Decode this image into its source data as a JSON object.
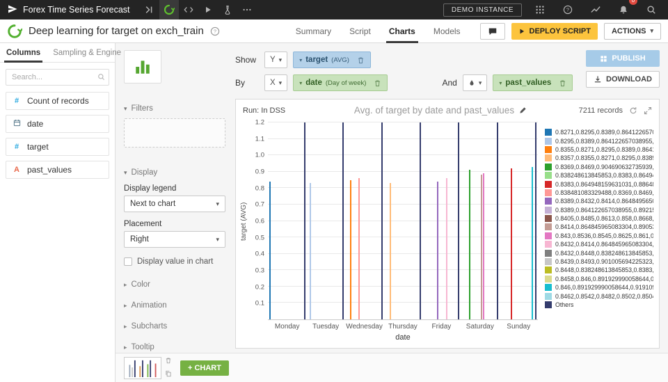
{
  "topnav": {
    "project_name": "Forex Time Series Forecast",
    "demo_instance_label": "DEMO INSTANCE",
    "notification_badge": "0"
  },
  "header": {
    "title": "Deep learning for target on exch_train",
    "tabs": [
      {
        "label": "Summary",
        "active": false
      },
      {
        "label": "Script",
        "active": false
      },
      {
        "label": "Charts",
        "active": true
      },
      {
        "label": "Models",
        "active": false
      }
    ],
    "deploy_button": "DEPLOY SCRIPT",
    "actions_button": "ACTIONS"
  },
  "sidebar": {
    "tabs": [
      {
        "label": "Columns",
        "active": true
      },
      {
        "label": "Sampling & Engine",
        "active": false
      }
    ],
    "search_placeholder": "Search...",
    "columns": [
      {
        "icon": "number",
        "name": "Count of records"
      },
      {
        "icon": "date",
        "name": "date"
      },
      {
        "icon": "number",
        "name": "target"
      },
      {
        "icon": "text",
        "name": "past_values"
      }
    ]
  },
  "config_panel": {
    "filters_label": "Filters",
    "display": {
      "label": "Display",
      "legend_label": "Display legend",
      "legend_value": "Next to chart",
      "placement_label": "Placement",
      "placement_value": "Right",
      "checkbox_label": "Display value in chart",
      "checkbox_checked": false
    },
    "collapsed_sections": [
      "Color",
      "Animation",
      "Subcharts",
      "Tooltip"
    ]
  },
  "chart_setup": {
    "show_label": "Show",
    "y_select": "Y",
    "y_field": "target",
    "y_qualifier": "(AVG)",
    "by_label": "By",
    "x_select": "X",
    "x_field": "date",
    "x_qualifier": "(Day of week)",
    "and_label": "And",
    "color_field": "past_values"
  },
  "actions_bar": {
    "publish_label": "PUBLISH",
    "download_label": "DOWNLOAD"
  },
  "chart_header": {
    "run_label": "Run: In DSS",
    "title": "Avg. of target by date and past_values",
    "records_label": "7211 records"
  },
  "chart_data": {
    "type": "bar",
    "title": "Avg. of target by date and past_values",
    "xlabel": "date",
    "ylabel": "target (AVG)",
    "ylim": [
      0,
      1.2
    ],
    "yticks": [
      0.1,
      0.2,
      0.3,
      0.4,
      0.5,
      0.6,
      0.7,
      0.8,
      0.9,
      1.0,
      1.1,
      1.2
    ],
    "grid": true,
    "legend_position": "right",
    "categories": [
      "Monday",
      "Tuesday",
      "Wednesday",
      "Thursday",
      "Friday",
      "Saturday",
      "Sunday"
    ],
    "series": [
      {
        "name": "0.8271,0.8295,0.8389,0.86412265703...",
        "color": "#1f77b4",
        "values": [
          0.84,
          0,
          0,
          0,
          0,
          0,
          0
        ]
      },
      {
        "name": "0.8295,0.8389,0.864122657038955,0...",
        "color": "#aec7e8",
        "values": [
          0,
          0.83,
          0,
          0,
          0,
          0,
          0
        ]
      },
      {
        "name": "0.8355,0.8271,0.8295,0.8389,0.86412...",
        "color": "#ff7f0e",
        "values": [
          0,
          0,
          0.85,
          0,
          0,
          0,
          0
        ]
      },
      {
        "name": "0.8357,0.8355,0.8271,0.8295,0.8389,0...",
        "color": "#ffbb78",
        "values": [
          0,
          0,
          0,
          0.83,
          0,
          0,
          0
        ]
      },
      {
        "name": "0.8369,0.8469,0.904690632735939,0...",
        "color": "#2ca02c",
        "values": [
          0,
          0,
          0,
          0,
          0,
          0.91,
          0
        ]
      },
      {
        "name": "0.838248613845853,0.8383,0.864948...",
        "color": "#98df8a",
        "values": [
          0,
          0,
          0,
          0,
          0,
          0,
          0
        ]
      },
      {
        "name": "0.8383,0.864948159631031,0.886488...",
        "color": "#d62728",
        "values": [
          0,
          0,
          0,
          0,
          0,
          0,
          0.92
        ]
      },
      {
        "name": "0.838481083329488,0.8369,0.8469,...",
        "color": "#ff9896",
        "values": [
          0,
          0,
          0.86,
          0,
          0,
          0,
          0
        ]
      },
      {
        "name": "0.8389,0.8432,0.8414,0.86484956508...",
        "color": "#9467bd",
        "values": [
          0,
          0,
          0,
          0,
          0.84,
          0,
          0
        ]
      },
      {
        "name": "0.8389,0.864122657038955,0.892154...",
        "color": "#c5b0d5",
        "values": [
          0,
          0,
          0,
          0,
          0,
          0,
          0
        ]
      },
      {
        "name": "0.8405,0.8485,0.8613,0.858,0.8668,0...",
        "color": "#8c564b",
        "values": [
          0,
          0,
          0,
          0,
          0,
          0,
          0
        ]
      },
      {
        "name": "0.8414,0.864845965083304,0.890530...",
        "color": "#c49c94",
        "values": [
          0,
          0,
          0,
          0,
          0,
          0.88,
          0
        ]
      },
      {
        "name": "0.843,0.8536,0.8545,0.8625,0.861,0.9...",
        "color": "#e377c2",
        "values": [
          0,
          0,
          0,
          0,
          0,
          0.89,
          0
        ]
      },
      {
        "name": "0.8432,0.8414,0.864845965083304,0...",
        "color": "#f7b6d2",
        "values": [
          0,
          0,
          0,
          0,
          0.86,
          0,
          0
        ]
      },
      {
        "name": "0.8432,0.8448,0.838248613845853,0...",
        "color": "#7f7f7f",
        "values": [
          0,
          0,
          0,
          0,
          0,
          0,
          0
        ]
      },
      {
        "name": "0.8439,0.8493,0.901005694225323,0...",
        "color": "#c7c7c7",
        "values": [
          0,
          0,
          0,
          0,
          0,
          0,
          0
        ]
      },
      {
        "name": "0.8448,0.838248613845853,0.8383,0...",
        "color": "#bcbd22",
        "values": [
          0,
          0,
          0,
          0,
          0,
          0,
          0
        ]
      },
      {
        "name": "0.8458,0.846,0.891929990058644,0.9...",
        "color": "#dbdb8d",
        "values": [
          0,
          0,
          0,
          0,
          0,
          0,
          0
        ]
      },
      {
        "name": "0.846,0.891929990058644,0.919109...",
        "color": "#17becf",
        "values": [
          0,
          0,
          0,
          0,
          0,
          0,
          0.93
        ]
      },
      {
        "name": "0.8462,0.8542,0.8482,0.8502,0.8504,0...",
        "color": "#9edae5",
        "values": [
          0,
          0,
          0,
          0,
          0,
          0,
          0
        ]
      },
      {
        "name": "Others",
        "color": "#343c6d",
        "values": [
          1.2,
          1.2,
          1.2,
          1.2,
          1.2,
          1.2,
          1.2
        ]
      }
    ]
  },
  "footer": {
    "add_chart_label": "+ CHART"
  }
}
